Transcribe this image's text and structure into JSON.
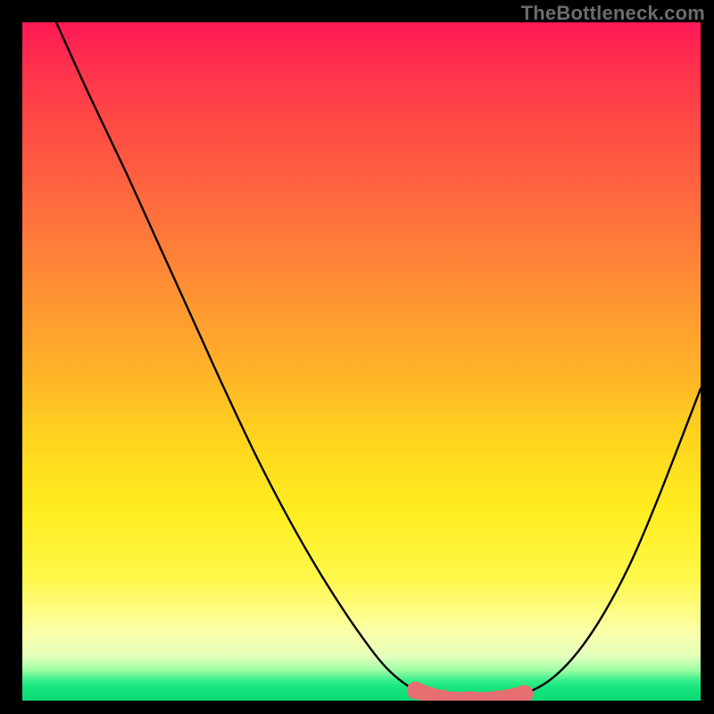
{
  "watermark": "TheBottleneck.com",
  "chart_data": {
    "type": "line",
    "title": "",
    "xlabel": "",
    "ylabel": "",
    "xlim": [
      0,
      100
    ],
    "ylim": [
      0,
      100
    ],
    "series": [
      {
        "name": "curve",
        "x": [
          5,
          10,
          15,
          20,
          25,
          30,
          35,
          40,
          45,
          50,
          54,
          58,
          62,
          66,
          70,
          74,
          78,
          82,
          86,
          90,
          94,
          100
        ],
        "values": [
          100,
          89,
          78.5,
          67.5,
          56.5,
          45.5,
          35,
          25.5,
          17,
          9.5,
          4.5,
          1.5,
          0.3,
          0.1,
          0.2,
          1,
          3.2,
          7.3,
          13.3,
          21,
          30.5,
          46
        ]
      }
    ],
    "highlight_band": {
      "x_start": 54,
      "x_end": 75,
      "y_max": 3.5
    },
    "background_gradient": {
      "top": "#ff1955",
      "mid": "#ffd61e",
      "bottom": "#0bdb75"
    }
  }
}
